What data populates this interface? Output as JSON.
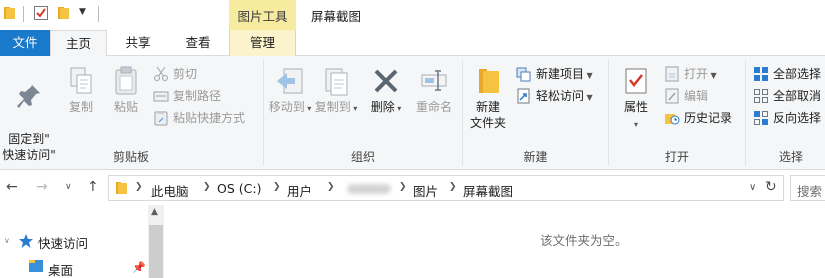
{
  "window": {
    "title": "屏幕截图",
    "context_tab_group": "图片工具"
  },
  "tabs": {
    "file": "文件",
    "home": "主页",
    "share": "共享",
    "view": "查看",
    "manage": "管理"
  },
  "ribbon": {
    "clipboard": {
      "label": "剪贴板",
      "pin": "固定到\"\n快速访问\"",
      "copy": "复制",
      "paste": "粘贴",
      "cut": "剪切",
      "copy_path": "复制路径",
      "paste_shortcut": "粘贴快捷方式"
    },
    "organize": {
      "label": "组织",
      "move_to": "移动到",
      "copy_to": "复制到",
      "delete": "删除",
      "rename": "重命名"
    },
    "new": {
      "label": "新建",
      "new_folder_line1": "新建",
      "new_folder_line2": "文件夹",
      "new_item": "新建项目",
      "easy_access": "轻松访问"
    },
    "open": {
      "label": "打开",
      "properties": "属性",
      "open": "打开",
      "edit": "编辑",
      "history": "历史记录"
    },
    "select": {
      "label": "选择",
      "select_all": "全部选择",
      "select_none": "全部取消",
      "invert": "反向选择"
    }
  },
  "address": {
    "crumbs": [
      "此电脑",
      "OS (C:)",
      "用户",
      "图片",
      "屏幕截图"
    ],
    "search_placeholder": "搜索"
  },
  "nav": {
    "quick_access": "快速访问",
    "desktop": "桌面"
  },
  "main": {
    "empty_message": "该文件夹为空。"
  },
  "colors": {
    "file_tab": "#1979ca",
    "context_tab": "#f6eb9f",
    "folder": "#f5c342",
    "accent_blue": "#2b7bd1"
  }
}
